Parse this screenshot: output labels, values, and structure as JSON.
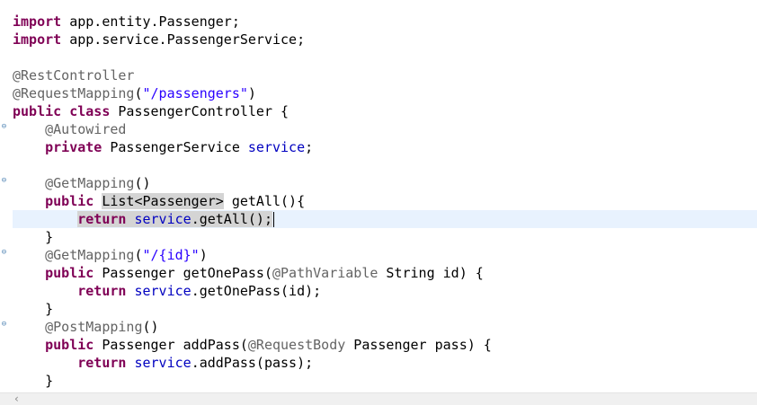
{
  "editor": {
    "lines": {
      "l1": {
        "kw": "import",
        "rest": " app.entity.Passenger;"
      },
      "l2": {
        "kw": "import",
        "rest": " app.service.PassengerService;"
      },
      "l4": {
        "ann": "@RestController"
      },
      "l5": {
        "ann": "@RequestMapping",
        "open": "(",
        "str": "\"/passengers\"",
        "close": ")"
      },
      "l6": {
        "kw1": "public",
        "kw2": "class",
        "rest": " PassengerController {"
      },
      "l7": {
        "ann": "@Autowired"
      },
      "l8": {
        "kw": "private",
        "type": " PassengerService ",
        "field": "service",
        "end": ";"
      },
      "l10": {
        "ann": "@GetMapping",
        "parens": "()"
      },
      "l11": {
        "kw": "public",
        "hl": "List<Passenger>",
        "rest": " getAll(){"
      },
      "l12": {
        "kw": "return",
        "field": "service",
        "rest": ".getAll();"
      },
      "l13": {
        "text": "}"
      },
      "l14": {
        "ann": "@GetMapping",
        "open": "(",
        "str": "\"/{id}\"",
        "close": ")"
      },
      "l15": {
        "kw": "public",
        "rest1": " Passenger getOnePass(",
        "ann": "@PathVariable",
        "rest2": " String id) {"
      },
      "l16": {
        "kw": "return",
        "field": "service",
        "rest": ".getOnePass(id);"
      },
      "l17": {
        "text": "}"
      },
      "l18": {
        "ann": "@PostMapping",
        "parens": "()"
      },
      "l19": {
        "kw": "public",
        "rest1": " Passenger addPass(",
        "ann": "@RequestBody",
        "rest2": " Passenger pass) {"
      },
      "l20": {
        "kw": "return",
        "field": "service",
        "rest": ".addPass(pass);"
      },
      "l21": {
        "text": "}"
      }
    },
    "fold_glyph": "⊖"
  },
  "scrollbar": {
    "left_arrow": "‹"
  }
}
